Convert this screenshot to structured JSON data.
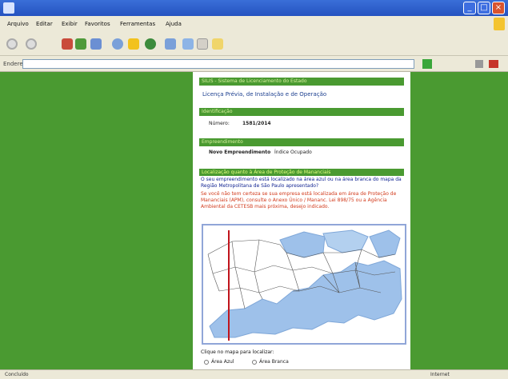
{
  "window": {
    "minimize_icon": "minimize-icon",
    "maximize_icon": "maximize-icon",
    "close_icon": "close-icon"
  },
  "menu": {
    "items": [
      "Arquivo",
      "Editar",
      "Exibir",
      "Favoritos",
      "Ferramentas",
      "Ajuda"
    ]
  },
  "address": {
    "label": "Endereço"
  },
  "page": {
    "header_bar": "SILIS - Sistema de Licenciamento do Estado",
    "title": "Licença Prévia, de Instalação e de Operação",
    "identification_bar": "Identificação",
    "number_label": "Número:",
    "number_value": "1581/2014",
    "enterprise_bar": "Empreendimento",
    "enterprise_name": "Novo Empreendimento",
    "enterprise_value": "Índice Ocupado",
    "question_bar": "Localização quanto à Área de Proteção de Mananciais",
    "question": "O seu empreendimento está localizado na área azul ou na área branca do mapa da Região Metropolitana de São Paulo apresentado?",
    "instructions": "Se você não tem certeza se sua empresa está localizada em área de Proteção de Mananciais (APM), consulte o Anexo Único / Mananc. Lei 898/75 ou a Agência Ambiental da CETESB mais próxima, desejo indicado.",
    "map_caption": "Clique no mapa para localizar:",
    "option_blue": "Área Azul",
    "option_white": "Área Branca"
  },
  "status": {
    "left": "Concluído",
    "right": "Internet"
  },
  "colors": {
    "titlebar": "#2452c0",
    "site_green": "#4a9a31",
    "link_blue": "#1c3f8f",
    "warning_red": "#d23b1c",
    "map_blue": "#9ec1ea",
    "marker_red": "#c0141c"
  }
}
